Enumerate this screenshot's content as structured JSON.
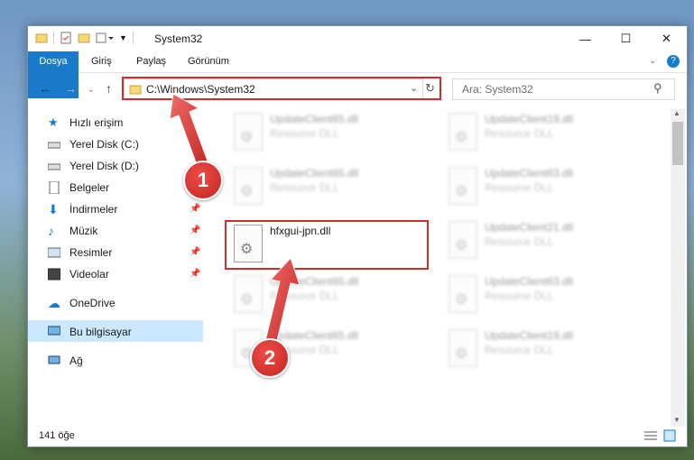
{
  "window": {
    "title": "System32",
    "controls": {
      "minimize": "—",
      "maximize": "☐",
      "close": "✕"
    }
  },
  "ribbon": {
    "tabs": [
      {
        "label": "Dosya"
      },
      {
        "label": "Giriş"
      },
      {
        "label": "Paylaş"
      },
      {
        "label": "Görünüm"
      }
    ]
  },
  "address": {
    "path": "C:\\Windows\\System32",
    "search_placeholder": "Ara: System32"
  },
  "sidebar": {
    "items": [
      {
        "label": "Hızlı erişim"
      },
      {
        "label": "Yerel Disk (C:)"
      },
      {
        "label": "Yerel Disk (D:)"
      },
      {
        "label": "Belgeler"
      },
      {
        "label": "İndirmeler"
      },
      {
        "label": "Müzik"
      },
      {
        "label": "Resimler"
      },
      {
        "label": "Videolar"
      },
      {
        "label": "OneDrive"
      },
      {
        "label": "Bu bilgisayar"
      },
      {
        "label": "Ağ"
      }
    ]
  },
  "files": [
    {
      "name": "UpdateClient65.dll",
      "desc": "Resource DLL"
    },
    {
      "name": "UpdateClient19.dll",
      "desc": "Resource DLL"
    },
    {
      "name": "UpdateClient65.dll",
      "desc": "Resource DLL"
    },
    {
      "name": "UpdateClient63.dll",
      "desc": "Resource DLL"
    },
    {
      "name": "hfxgui-jpn.dll",
      "desc": ""
    },
    {
      "name": "UpdateClient21.dll",
      "desc": "Resource DLL"
    },
    {
      "name": "UpdateClient65.dll",
      "desc": "Resource DLL"
    },
    {
      "name": "UpdateClient63.dll",
      "desc": "Resource DLL"
    },
    {
      "name": "UpdateClient65.dll",
      "desc": "Resource DLL"
    },
    {
      "name": "UpdateClient19.dll",
      "desc": "Resource DLL"
    }
  ],
  "status": {
    "count": "141 öğe"
  },
  "annotations": {
    "step1": "1",
    "step2": "2"
  },
  "colors": {
    "accent": "#1979ca",
    "highlight": "#d32a2a",
    "selection": "#cce8ff"
  }
}
